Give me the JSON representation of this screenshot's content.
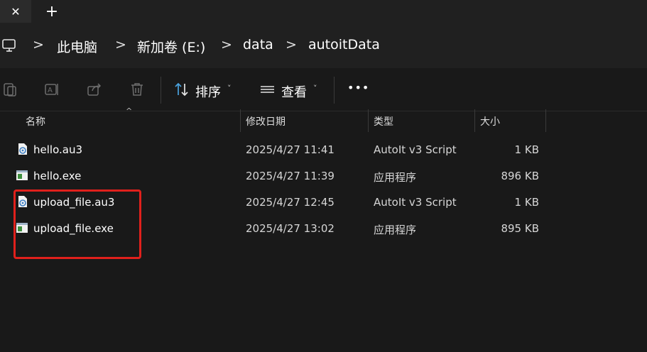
{
  "tabbar": {
    "close_glyph": "✕",
    "new_tab_glyph": "+"
  },
  "breadcrumb": {
    "root_icon": "computer-icon",
    "separator": ">",
    "items": [
      "此电脑",
      "新加卷 (E:)",
      "data",
      "autoitData"
    ]
  },
  "toolbar": {
    "icons": [
      "clipboard-icon",
      "rename-icon",
      "share-icon",
      "delete-icon"
    ],
    "sort_label": "排序",
    "view_label": "查看",
    "more_glyph": "•••",
    "caret_glyph": "˅"
  },
  "columns": {
    "name": "名称",
    "modified": "修改日期",
    "type": "类型",
    "size": "大小",
    "sort_glyph": "^"
  },
  "files": [
    {
      "name": "hello.au3",
      "modified": "2025/4/27 11:41",
      "type": "AutoIt v3 Script",
      "size": "1 KB",
      "icon": "au3-script-icon"
    },
    {
      "name": "hello.exe",
      "modified": "2025/4/27 11:39",
      "type": "应用程序",
      "size": "896 KB",
      "icon": "exe-app-icon"
    },
    {
      "name": "upload_file.au3",
      "modified": "2025/4/27 12:45",
      "type": "AutoIt v3 Script",
      "size": "1 KB",
      "icon": "au3-script-icon"
    },
    {
      "name": "upload_file.exe",
      "modified": "2025/4/27 13:02",
      "type": "应用程序",
      "size": "895 KB",
      "icon": "exe-app-icon"
    }
  ],
  "colors": {
    "background": "#191919",
    "chrome": "#202020",
    "annotation": "#e0201c",
    "accent_icon": "#4aa3df"
  }
}
